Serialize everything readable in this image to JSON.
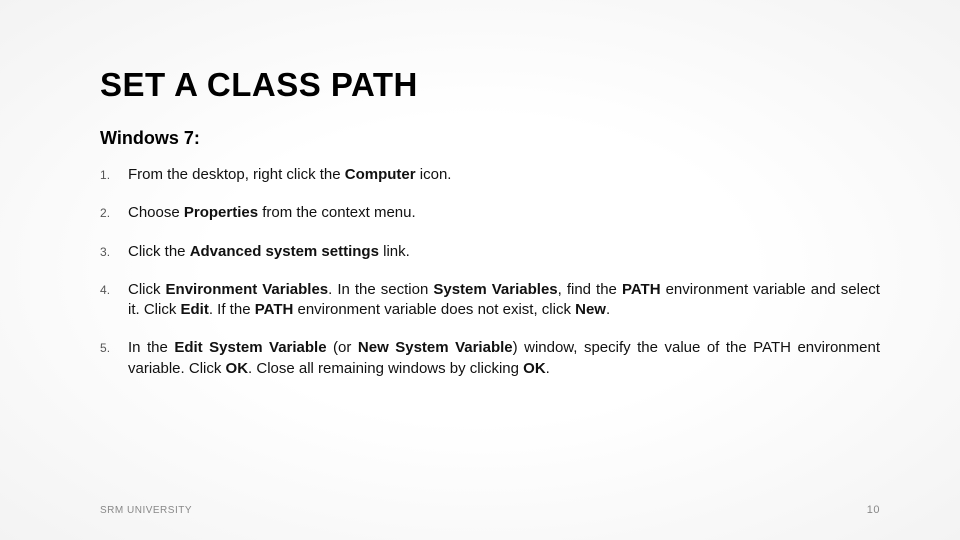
{
  "title": "SET A CLASS PATH",
  "subtitle": "Windows 7:",
  "steps": {
    "s1": {
      "pre": "From the desktop, right click the ",
      "bold": "Computer",
      "post": " icon."
    },
    "s2": {
      "pre": "Choose ",
      "bold": "Properties",
      "post": " from the context menu."
    },
    "s3": {
      "pre": "Click the ",
      "bold": "Advanced system settings",
      "post": " link."
    },
    "s4": {
      "t1": "Click ",
      "b1": "Environment Variables",
      "t2": ". In the section ",
      "b2": "System Variables",
      "t3": ", find the ",
      "b3": "PATH",
      "t4": " environment variable and select it. Click ",
      "b4": "Edit",
      "t5": ". If the ",
      "b5": "PATH",
      "t6": " environment variable does not exist, click ",
      "b6": "New",
      "t7": "."
    },
    "s5": {
      "t1": "In the ",
      "b1": "Edit System Variable",
      "t2": " (or ",
      "b2": "New System Variable",
      "t3": ") window, specify the value of the PATH environment variable. Click ",
      "b3": "OK",
      "t4": ". Close all remaining windows by clicking ",
      "b4": "OK",
      "t5": "."
    }
  },
  "footer": {
    "org": "SRM UNIVERSITY",
    "page": "10"
  }
}
